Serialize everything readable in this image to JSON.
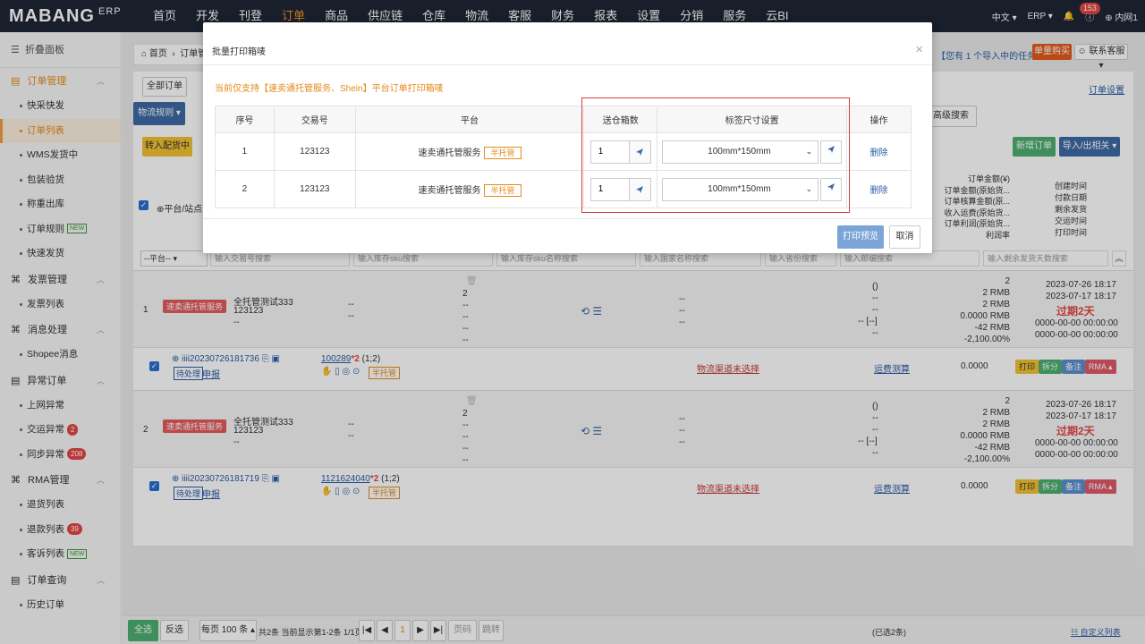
{
  "topbar": {
    "logo": "MABANG",
    "logo_suffix": "ERP",
    "nav": [
      "首页",
      "开发",
      "刊登",
      "订单",
      "商品",
      "供应链",
      "仓库",
      "物流",
      "客服",
      "财务",
      "报表",
      "设置",
      "分销",
      "服务",
      "云BI"
    ],
    "active_nav": "订单",
    "lang": "中文",
    "erp": "ERP",
    "notify_count": "153",
    "user": "内网1"
  },
  "sidebar": {
    "collapse_label": "折叠面板",
    "groups": [
      {
        "label": "订单管理",
        "items": [
          {
            "label": "快采快发"
          },
          {
            "label": "订单列表",
            "active": true
          },
          {
            "label": "WMS发货中"
          },
          {
            "label": "包装验货"
          },
          {
            "label": "称重出库"
          },
          {
            "label": "订单规则",
            "tag": "NEW"
          },
          {
            "label": "快速发货"
          }
        ]
      },
      {
        "label": "发票管理",
        "items": [
          {
            "label": "发票列表"
          }
        ]
      },
      {
        "label": "消息处理",
        "items": [
          {
            "label": "Shopee消息"
          }
        ]
      },
      {
        "label": "异常订单",
        "items": [
          {
            "label": "上网异常"
          },
          {
            "label": "交运异常",
            "count": "2"
          },
          {
            "label": "同步异常",
            "count": "208"
          }
        ]
      },
      {
        "label": "RMA管理",
        "items": [
          {
            "label": "退货列表"
          },
          {
            "label": "退款列表",
            "count": "39"
          },
          {
            "label": "客诉列表",
            "tag": "NEW"
          }
        ]
      },
      {
        "label": "订单查询",
        "items": [
          {
            "label": "历史订单"
          }
        ]
      }
    ]
  },
  "page": {
    "breadcrumb_home": "首页",
    "breadcrumb_current": "订单管",
    "task_text": "您有 1 个导入中的任务",
    "buy_button": "单量购买",
    "support_button": "联系客服",
    "order_settings": "订单设置",
    "tab_all": "全部订单",
    "logistics_rule": "物流规则",
    "transfer_btn": "转入配货中",
    "advanced_search": "高级搜索",
    "new_order": "新增订单",
    "import_export": "导入/出相关",
    "platform_site": "平台/站点",
    "right_header_lines": [
      "订单金额(¥)",
      "订单金额(原始货...",
      "订单核算金额(原...",
      "收入运费(原始货...",
      "订单利润(原始货...",
      "利润率"
    ],
    "right_time_lines": [
      "创建时间",
      "付款日期",
      "剩余发货",
      "交运时间",
      "打印时间"
    ],
    "filter_platform": "--平台--",
    "filter_placeholders": [
      "输入交易号搜索",
      "输入库存sku搜索",
      "输入库存sku名称搜索",
      "输入国家名称搜索",
      "输入省份搜索",
      "输入邮编搜索",
      "输入剩余发货天数搜索"
    ]
  },
  "orders": [
    {
      "index": "1",
      "platform_tag": "速卖通托管服务",
      "shop": "全托管测试333",
      "trade_no": "123123",
      "dash": "--",
      "order_id": "iiii20230726181736",
      "status": "待处理",
      "apply": "申报",
      "sku": "100289",
      "qty": "*2",
      "qty_note": "(1;2)",
      "half": "半托管",
      "logistics": "物流渠道未选择",
      "freight": "运费测算",
      "amount": "0.0000",
      "right_vals": [
        "2",
        "2 RMB",
        "2 RMB",
        "0.0000 RMB",
        "-42 RMB",
        "-2,100.00%"
      ],
      "create_time": "2023-07-26 18:17",
      "pay_time": "2023-07-17 18:17",
      "overdue": "过期2天",
      "t1": "0000-00-00 00:00:00",
      "t2": "0000-00-00 00:00:00"
    },
    {
      "index": "2",
      "platform_tag": "速卖通托管服务",
      "shop": "全托管测试333",
      "trade_no": "123123",
      "dash": "--",
      "order_id": "iiii20230726181719",
      "status": "待处理",
      "apply": "申报",
      "sku": "1121624040",
      "qty": "*2",
      "qty_note": "(1;2)",
      "half": "半托管",
      "logistics": "物流渠道未选择",
      "freight": "运费测算",
      "amount": "0.0000",
      "right_vals": [
        "2",
        "2 RMB",
        "2 RMB",
        "0.0000 RMB",
        "-42 RMB",
        "-2,100.00%"
      ],
      "create_time": "2023-07-26 18:17",
      "pay_time": "2023-07-17 18:17",
      "overdue": "过期2天",
      "t1": "0000-00-00 00:00:00",
      "t2": "0000-00-00 00:00:00"
    }
  ],
  "row_actions": {
    "print": "打印",
    "split": "拆分",
    "remark": "备注",
    "rma": "RMA"
  },
  "pager": {
    "select_all": "全选",
    "invert": "反选",
    "per_page": "每页 100 条",
    "summary": "共2条 当前显示第1-2条 1/1页",
    "current": "1",
    "page_placeholder": "页码",
    "jump": "跳转",
    "selected": "(已选2条)",
    "custom": "自定义列表"
  },
  "modal": {
    "title": "批量打印箱唛",
    "note": "当前仅支持【速卖通托管服务、Shein】平台订单打印箱唛",
    "headers": [
      "序号",
      "交易号",
      "平台",
      "送仓箱数",
      "标签尺寸设置",
      "操作"
    ],
    "rows": [
      {
        "index": "1",
        "trade_no": "123123",
        "platform": "速卖通托管服务",
        "tag": "半托管",
        "boxes": "1",
        "size": "100mm*150mm",
        "action": "删除"
      },
      {
        "index": "2",
        "trade_no": "123123",
        "platform": "速卖通托管服务",
        "tag": "半托管",
        "boxes": "1",
        "size": "100mm*150mm",
        "action": "删除"
      }
    ],
    "preview_button": "打印预览",
    "cancel_button": "取消"
  }
}
